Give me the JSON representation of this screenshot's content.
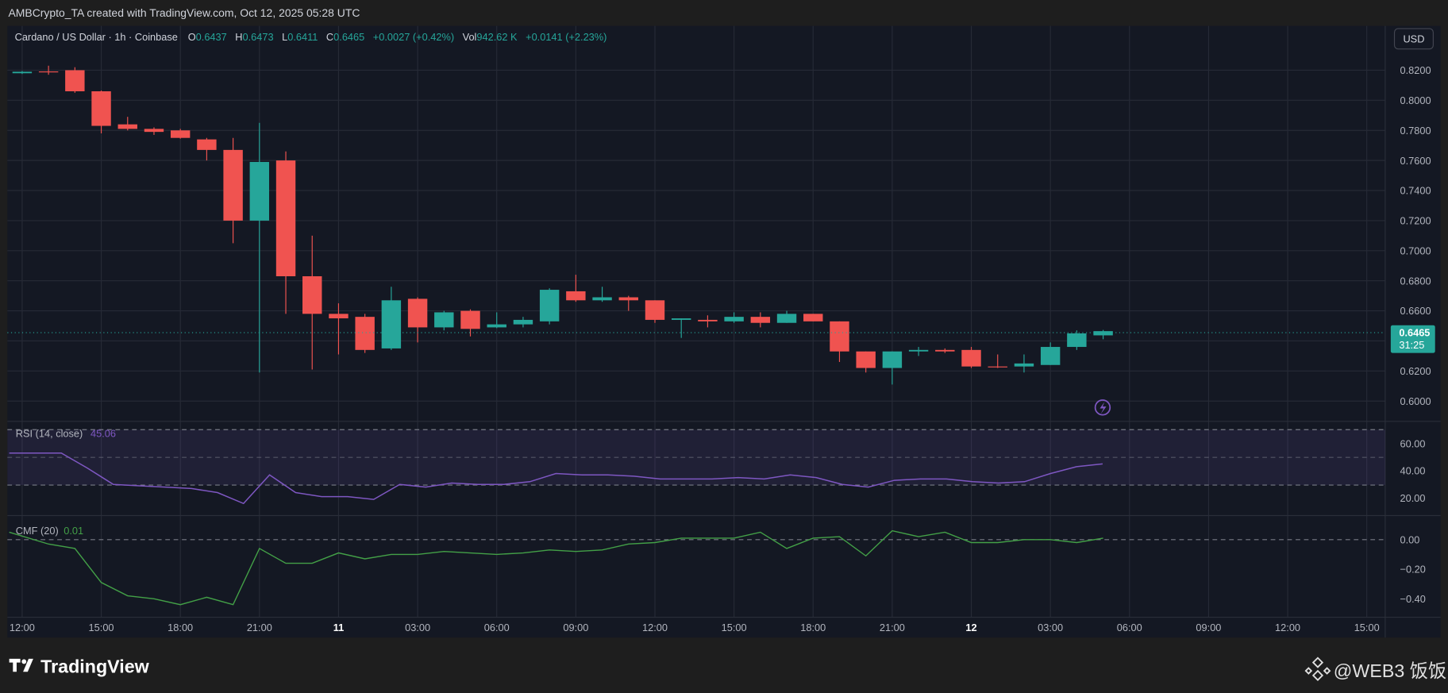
{
  "header": {
    "caption": "AMBCrypto_TA created with TradingView.com, Oct 12, 2025 05:28 UTC"
  },
  "legend": {
    "symbol": "Cardano / US Dollar · 1h · Coinbase",
    "o_label": "O",
    "o": "0.6437",
    "h_label": "H",
    "h": "0.6473",
    "l_label": "L",
    "l": "0.6411",
    "c_label": "C",
    "c": "0.6465",
    "change": "+0.0027 (+0.42%)",
    "vol_label": "Vol",
    "vol": "942.62 K",
    "vol_change": "+0.0141 (+2.23%)"
  },
  "currency_button": "USD",
  "price_label": {
    "price": "0.6465",
    "countdown": "31:25"
  },
  "colors": {
    "up": "#26a69a",
    "down": "#f05350",
    "rsi": "#7e57c2",
    "cmf": "#43a047",
    "background": "#141823",
    "grid": "#262a36"
  },
  "price_axis": [
    "0.8200",
    "0.8000",
    "0.7800",
    "0.7600",
    "0.7400",
    "0.7200",
    "0.7000",
    "0.6800",
    "0.6600",
    "0.6400",
    "0.6200",
    "0.6000"
  ],
  "time_axis": [
    "12:00",
    "15:00",
    "18:00",
    "21:00",
    "11",
    "03:00",
    "06:00",
    "09:00",
    "12:00",
    "15:00",
    "18:00",
    "21:00",
    "12",
    "03:00",
    "06:00",
    "09:00",
    "12:00",
    "15:00"
  ],
  "rsi": {
    "label": "RSI (14, close)",
    "value": "45.06",
    "axis": [
      "60.00",
      "40.00",
      "20.00"
    ],
    "series": [
      53,
      53,
      53,
      42,
      30,
      29,
      28,
      27,
      24,
      16,
      37,
      24,
      21,
      21,
      19,
      30,
      28,
      31,
      30,
      30,
      32,
      38,
      37,
      37,
      36,
      34,
      34,
      34,
      35,
      34,
      37,
      35,
      30,
      28,
      33,
      34,
      34,
      32,
      31,
      32,
      38,
      43,
      45.06
    ]
  },
  "cmf": {
    "label": "CMF (20)",
    "value": "0.01",
    "axis": [
      "0.00",
      "−0.20",
      "−0.40"
    ],
    "series": [
      0.05,
      -0.03,
      -0.06,
      -0.29,
      -0.38,
      -0.4,
      -0.44,
      -0.39,
      -0.44,
      -0.06,
      -0.16,
      -0.16,
      -0.09,
      -0.13,
      -0.1,
      -0.1,
      -0.08,
      -0.09,
      -0.1,
      -0.09,
      -0.07,
      -0.08,
      -0.07,
      -0.03,
      -0.02,
      0.01,
      0.01,
      0.01,
      0.05,
      -0.06,
      0.01,
      0.02,
      -0.11,
      0.06,
      0.02,
      0.05,
      -0.02,
      -0.02,
      0.0,
      0.0,
      -0.02,
      0.01
    ]
  },
  "chart_data": {
    "type": "candlestick",
    "interval": "1h",
    "ohlc": [
      [
        0.818,
        0.8195,
        0.8175,
        0.819
      ],
      [
        0.8192,
        0.823,
        0.817,
        0.8188
      ],
      [
        0.82,
        0.822,
        0.805,
        0.806
      ],
      [
        0.806,
        0.8065,
        0.778,
        0.783
      ],
      [
        0.784,
        0.789,
        0.78,
        0.781
      ],
      [
        0.781,
        0.782,
        0.777,
        0.779
      ],
      [
        0.78,
        0.781,
        0.7745,
        0.775
      ],
      [
        0.774,
        0.775,
        0.76,
        0.767
      ],
      [
        0.767,
        0.775,
        0.705,
        0.72
      ],
      [
        0.72,
        0.785,
        0.619,
        0.759
      ],
      [
        0.76,
        0.766,
        0.658,
        0.683
      ],
      [
        0.683,
        0.71,
        0.621,
        0.658
      ],
      [
        0.658,
        0.665,
        0.631,
        0.655
      ],
      [
        0.656,
        0.658,
        0.632,
        0.634
      ],
      [
        0.635,
        0.676,
        0.634,
        0.667
      ],
      [
        0.668,
        0.669,
        0.639,
        0.649
      ],
      [
        0.649,
        0.66,
        0.647,
        0.659
      ],
      [
        0.66,
        0.661,
        0.643,
        0.648
      ],
      [
        0.649,
        0.659,
        0.6485,
        0.651
      ],
      [
        0.651,
        0.656,
        0.649,
        0.654
      ],
      [
        0.653,
        0.675,
        0.651,
        0.674
      ],
      [
        0.673,
        0.684,
        0.666,
        0.667
      ],
      [
        0.667,
        0.676,
        0.666,
        0.669
      ],
      [
        0.669,
        0.67,
        0.66,
        0.667
      ],
      [
        0.667,
        0.667,
        0.652,
        0.654
      ],
      [
        0.654,
        0.655,
        0.642,
        0.655
      ],
      [
        0.654,
        0.657,
        0.649,
        0.653
      ],
      [
        0.653,
        0.659,
        0.652,
        0.656
      ],
      [
        0.656,
        0.659,
        0.649,
        0.652
      ],
      [
        0.652,
        0.66,
        0.652,
        0.658
      ],
      [
        0.658,
        0.658,
        0.653,
        0.653
      ],
      [
        0.653,
        0.653,
        0.626,
        0.633
      ],
      [
        0.633,
        0.633,
        0.619,
        0.622
      ],
      [
        0.622,
        0.633,
        0.611,
        0.633
      ],
      [
        0.633,
        0.636,
        0.63,
        0.634
      ],
      [
        0.634,
        0.635,
        0.632,
        0.633
      ],
      [
        0.634,
        0.636,
        0.622,
        0.623
      ],
      [
        0.623,
        0.631,
        0.622,
        0.6225
      ],
      [
        0.623,
        0.631,
        0.619,
        0.625
      ],
      [
        0.624,
        0.639,
        0.624,
        0.636
      ],
      [
        0.636,
        0.647,
        0.634,
        0.645
      ],
      [
        0.6437,
        0.6473,
        0.6411,
        0.6465
      ]
    ],
    "ylim": [
      0.59,
      0.83
    ]
  },
  "watermark": {
    "brand": "TradingView",
    "source": "@WEB3 饭饭"
  }
}
